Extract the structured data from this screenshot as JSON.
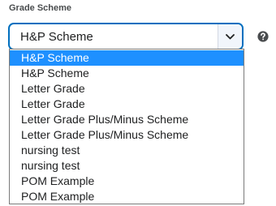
{
  "grade_scheme": {
    "label": "Grade Scheme",
    "selected_value": "H&P Scheme",
    "arrow_icon": "chevron-down-icon",
    "help_icon": "question-circle-icon",
    "accent_color": "#006fbf",
    "highlight_color": "#1e90ff",
    "options": [
      {
        "label": "H&P Scheme",
        "highlighted": true
      },
      {
        "label": "H&P Scheme",
        "highlighted": false
      },
      {
        "label": "Letter Grade",
        "highlighted": false
      },
      {
        "label": "Letter Grade",
        "highlighted": false
      },
      {
        "label": "Letter Grade Plus/Minus Scheme",
        "highlighted": false
      },
      {
        "label": "Letter Grade Plus/Minus Scheme",
        "highlighted": false
      },
      {
        "label": "nursing test",
        "highlighted": false
      },
      {
        "label": "nursing test",
        "highlighted": false
      },
      {
        "label": "POM Example",
        "highlighted": false
      },
      {
        "label": "POM Example",
        "highlighted": false
      }
    ]
  }
}
